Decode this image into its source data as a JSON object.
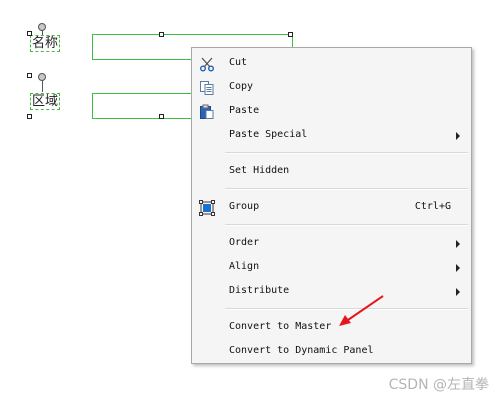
{
  "canvas": {
    "labels": [
      "名称",
      "区域"
    ]
  },
  "menu": {
    "items": [
      {
        "label": "Cut",
        "icon": "scissors-icon"
      },
      {
        "label": "Copy",
        "icon": "copy-icon"
      },
      {
        "label": "Paste",
        "icon": "paste-icon"
      },
      {
        "label": "Paste Special",
        "submenu": true
      },
      {
        "label": "Set Hidden"
      },
      {
        "label": "Group",
        "shortcut": "Ctrl+G",
        "icon": "group-icon"
      },
      {
        "label": "Order",
        "submenu": true
      },
      {
        "label": "Align",
        "submenu": true
      },
      {
        "label": "Distribute",
        "submenu": true
      },
      {
        "label": "Convert to Master"
      },
      {
        "label": "Convert to Dynamic Panel"
      }
    ]
  },
  "annotation": {
    "arrow_color": "#e8141b",
    "target": "Convert to Master"
  },
  "watermark": "CSDN @左直拳",
  "colors": {
    "selection_green": "#3fbf3f",
    "menu_bg": "#f5f5f5"
  }
}
